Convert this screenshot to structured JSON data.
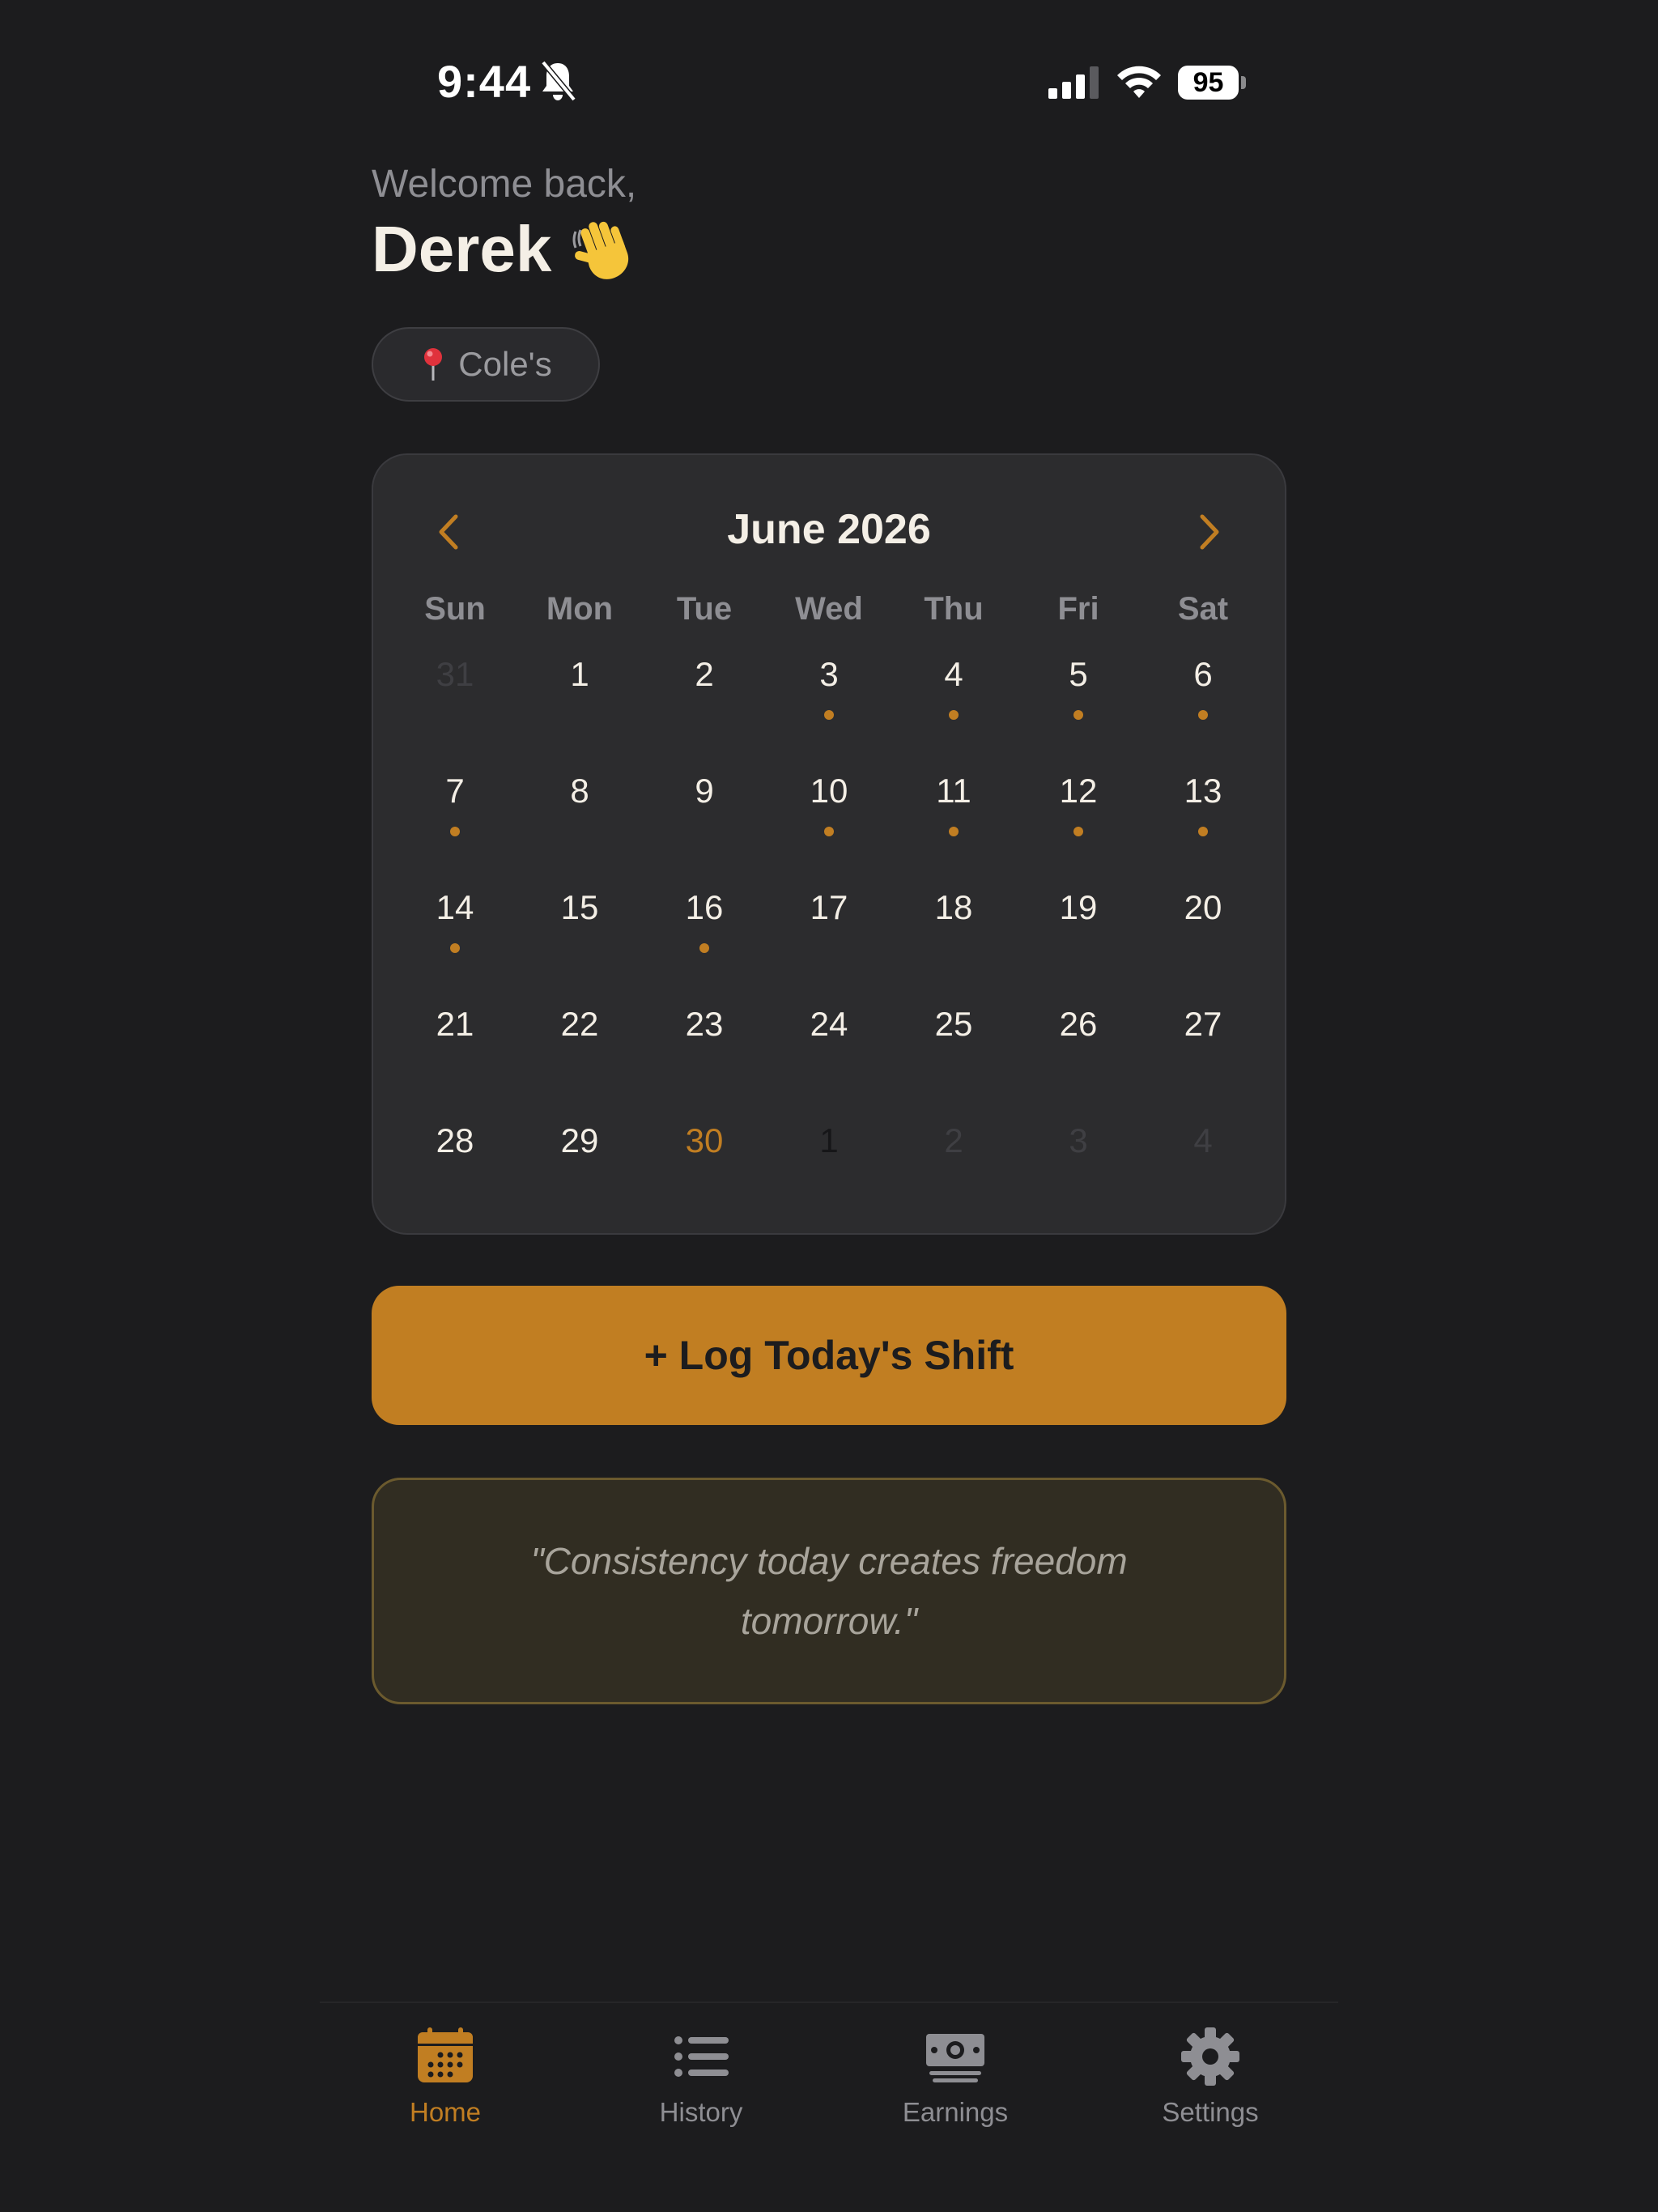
{
  "status_bar": {
    "time": "9:44",
    "battery": "95"
  },
  "greeting": {
    "welcome": "Welcome back,",
    "name": "Derek"
  },
  "location": {
    "label": "Cole's"
  },
  "calendar": {
    "title": "June 2026",
    "weekdays": [
      "Sun",
      "Mon",
      "Tue",
      "Wed",
      "Thu",
      "Fri",
      "Sat"
    ],
    "days": [
      {
        "label": "31",
        "state": "muted-light",
        "dot": false
      },
      {
        "label": "1",
        "state": "normal",
        "dot": false
      },
      {
        "label": "2",
        "state": "normal",
        "dot": false
      },
      {
        "label": "3",
        "state": "normal",
        "dot": true
      },
      {
        "label": "4",
        "state": "normal",
        "dot": true
      },
      {
        "label": "5",
        "state": "normal",
        "dot": true
      },
      {
        "label": "6",
        "state": "normal",
        "dot": true
      },
      {
        "label": "7",
        "state": "normal",
        "dot": true
      },
      {
        "label": "8",
        "state": "normal",
        "dot": false
      },
      {
        "label": "9",
        "state": "normal",
        "dot": false
      },
      {
        "label": "10",
        "state": "normal",
        "dot": true
      },
      {
        "label": "11",
        "state": "normal",
        "dot": true
      },
      {
        "label": "12",
        "state": "normal",
        "dot": true
      },
      {
        "label": "13",
        "state": "normal",
        "dot": true
      },
      {
        "label": "14",
        "state": "normal",
        "dot": true
      },
      {
        "label": "15",
        "state": "normal",
        "dot": false
      },
      {
        "label": "16",
        "state": "normal",
        "dot": true
      },
      {
        "label": "17",
        "state": "normal",
        "dot": false
      },
      {
        "label": "18",
        "state": "normal",
        "dot": false
      },
      {
        "label": "19",
        "state": "normal",
        "dot": false
      },
      {
        "label": "20",
        "state": "normal",
        "dot": false
      },
      {
        "label": "21",
        "state": "normal",
        "dot": false
      },
      {
        "label": "22",
        "state": "normal",
        "dot": false
      },
      {
        "label": "23",
        "state": "normal",
        "dot": false
      },
      {
        "label": "24",
        "state": "normal",
        "dot": false
      },
      {
        "label": "25",
        "state": "normal",
        "dot": false
      },
      {
        "label": "26",
        "state": "normal",
        "dot": false
      },
      {
        "label": "27",
        "state": "normal",
        "dot": false
      },
      {
        "label": "28",
        "state": "normal",
        "dot": false
      },
      {
        "label": "29",
        "state": "normal",
        "dot": false
      },
      {
        "label": "30",
        "state": "today",
        "dot": false
      },
      {
        "label": "1",
        "state": "muted-dark",
        "dot": false
      },
      {
        "label": "2",
        "state": "muted-light",
        "dot": false
      },
      {
        "label": "3",
        "state": "muted-light",
        "dot": false
      },
      {
        "label": "4",
        "state": "muted-light",
        "dot": false
      }
    ]
  },
  "log_button": {
    "label": "+ Log Today's Shift"
  },
  "quote": {
    "text": "\"Consistency today creates freedom tomorrow.\""
  },
  "tabs": [
    {
      "label": "Home",
      "icon": "calendar-icon",
      "active": true
    },
    {
      "label": "History",
      "icon": "list-icon",
      "active": false
    },
    {
      "label": "Earnings",
      "icon": "money-icon",
      "active": false
    },
    {
      "label": "Settings",
      "icon": "gear-icon",
      "active": false
    }
  ],
  "colors": {
    "background": "#1c1c1e",
    "card": "#2c2c2e",
    "accent": "#c17e22",
    "text": "#f4efe6",
    "muted": "#8e8e93"
  }
}
